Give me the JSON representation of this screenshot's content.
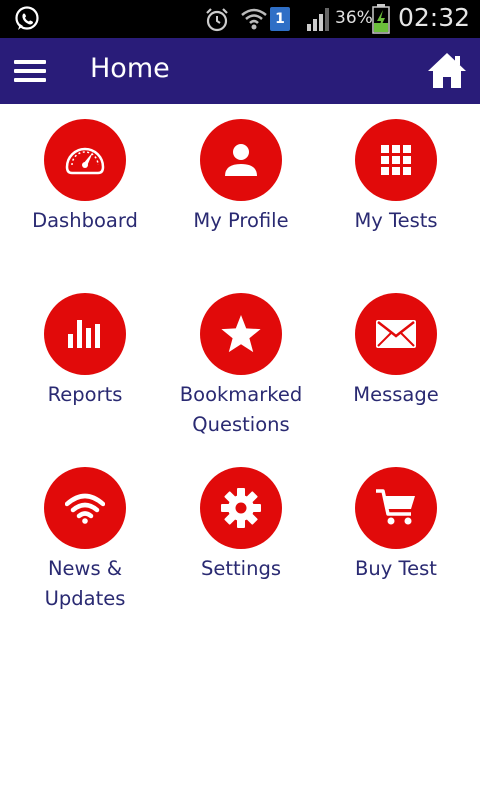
{
  "status_bar": {
    "battery_percent": "36%",
    "time": "02:32",
    "sim_badge": "1",
    "icons": [
      "whatsapp-icon",
      "alarm-icon",
      "wifi-icon",
      "sim-icon",
      "signal-icon",
      "battery-charging-icon"
    ]
  },
  "app_bar": {
    "title": "Home",
    "menu_icon": "hamburger-menu-icon",
    "home_icon": "home-icon",
    "background": "#291c79"
  },
  "tiles": [
    {
      "label": "Dashboard",
      "icon": "speedometer-icon"
    },
    {
      "label": "My Profile",
      "icon": "person-icon"
    },
    {
      "label": "My Tests",
      "icon": "grid-icon"
    },
    {
      "label": "Reports",
      "icon": "bar-chart-icon"
    },
    {
      "label": "Bookmarked\nQuestions",
      "icon": "star-icon"
    },
    {
      "label": "Message",
      "icon": "envelope-icon"
    },
    {
      "label": "News &\nUpdates",
      "icon": "wifi-signal-icon"
    },
    {
      "label": "Settings",
      "icon": "gear-icon"
    },
    {
      "label": "Buy Test",
      "icon": "shopping-cart-icon"
    }
  ],
  "colors": {
    "accent": "#e10a0a",
    "label_text": "#2a2a72",
    "app_bar": "#291c79"
  }
}
